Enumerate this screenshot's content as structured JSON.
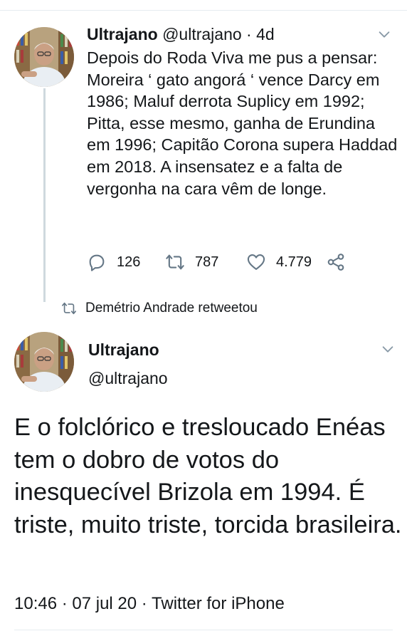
{
  "tweet1": {
    "name": "Ultrajano",
    "handle": "@ultrajano",
    "separator": " · ",
    "age": "4d",
    "text": "Depois do Roda Viva me pus a pensar: Moreira ‘ gato angorá ‘ vence Darcy em 1986; Maluf derrota Suplicy em 1992; Pitta, esse mesmo, ganha de Erundina em 1996; Capitão Corona supera Haddad em 2018. A insensatez e a falta de vergonha na cara vêm de longe.",
    "replies": "126",
    "retweets": "787",
    "likes": "4.779"
  },
  "retweet_note": "Demétrio Andrade retweetou",
  "tweet2": {
    "name": "Ultrajano",
    "handle": "@ultrajano",
    "text": "E o folclórico e tresloucado Enéas tem o dobro de votos do inesquecível Brizola em 1994. É triste, muito triste, torcida brasileira.",
    "time": "10:46",
    "date": "07 jul 20",
    "source": "Twitter for iPhone",
    "separator": " · "
  },
  "icons": [
    "chevron-down-icon",
    "reply-icon",
    "retweet-icon",
    "heart-icon",
    "share-icon"
  ],
  "colors": {
    "icon_gray": "#657786",
    "thread_line": "#cfd9de",
    "text": "#14171a"
  }
}
